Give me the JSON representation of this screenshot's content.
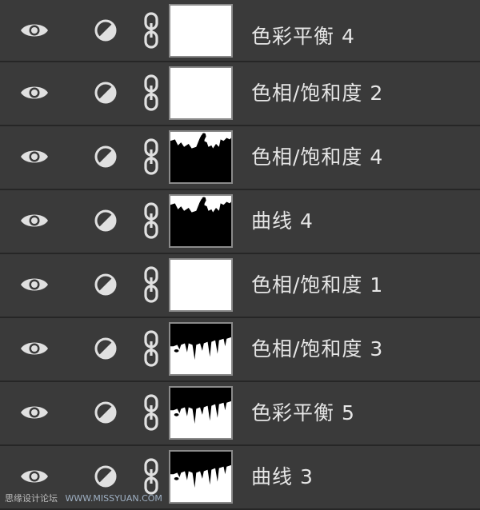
{
  "layers": [
    {
      "name": "色彩平衡 4",
      "mask": "white"
    },
    {
      "name": "色相/饱和度 2",
      "mask": "white"
    },
    {
      "name": "色相/饱和度 4",
      "mask": "figure"
    },
    {
      "name": "曲线 4",
      "mask": "figure"
    },
    {
      "name": "色相/饱和度 1",
      "mask": "white"
    },
    {
      "name": "色相/饱和度 3",
      "mask": "drips"
    },
    {
      "name": "色彩平衡 5",
      "mask": "drips"
    },
    {
      "name": "曲线 3",
      "mask": "drips"
    }
  ],
  "icons": {
    "visibility": "eye-icon",
    "adjustment": "adjustment-layer-icon",
    "link": "chain-link-icon"
  },
  "footer": {
    "watermark": "思缘设计论坛",
    "site": "WWW.MISSYUAN.COM"
  },
  "colors": {
    "panel_bg": "#3a3a3a",
    "divider": "#262626",
    "text": "#e6e6e6",
    "icon": "#e0e0e0"
  }
}
